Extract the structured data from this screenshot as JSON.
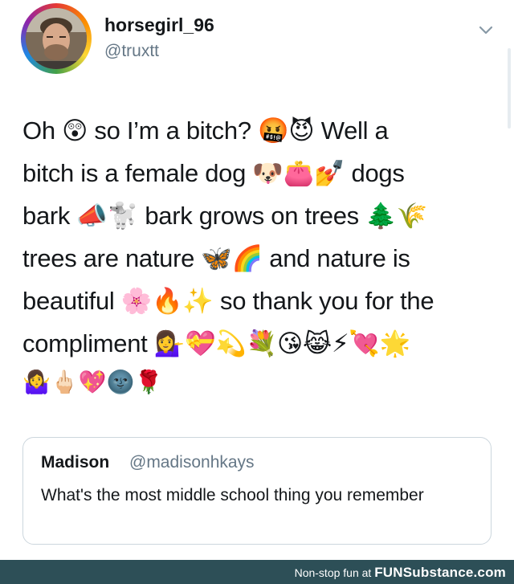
{
  "tweet": {
    "display_name": "horsegirl_96",
    "handle": "@truxtt",
    "avatar_ring_colors": [
      "#e53935",
      "#fb8c00",
      "#fdd835",
      "#43a047",
      "#1e88e5",
      "#8e24aa"
    ],
    "menu_icon": "chevron-down-icon",
    "lines": [
      "Oh 😲 so I’m a bitch? 🤬😈 Well a",
      "bitch is a female dog 🐶👛💅 dogs",
      "bark 📣🐩 bark grows on trees 🌲🌾",
      "trees are nature 🦋🌈 and nature is",
      "beautiful 🌸🔥✨ so thank you for the",
      "compliment 💁‍♀️💝💫💐😘😹⚡💘🌟"
    ],
    "emoji_row": "🤷‍♀️🖕🏻💖🌚🌹"
  },
  "quoted_tweet": {
    "name": "Madison",
    "handle": "@madisonhkays",
    "text": "What's the most middle school thing you remember"
  },
  "footer": {
    "text": "Non-stop fun at",
    "brand": "FUNSubstance.com",
    "background": "#2d4f57"
  },
  "colors": {
    "text": "#14171a",
    "secondary": "#657786",
    "border": "#ccd6dd"
  }
}
